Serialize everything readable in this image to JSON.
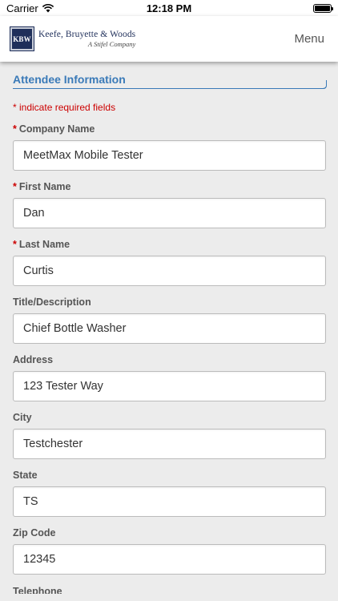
{
  "status_bar": {
    "carrier": "Carrier",
    "time": "12:18 PM"
  },
  "header": {
    "logo_mark": "KBW",
    "logo_name": "Keefe, Bruyette & Woods",
    "logo_subtitle": "A Stifel Company",
    "menu_label": "Menu"
  },
  "form": {
    "section_title": "Attendee Information",
    "required_note": "* indicate required fields",
    "required_marker": "*",
    "fields": [
      {
        "label": "Company Name",
        "value": "MeetMax Mobile Tester"
      },
      {
        "label": "First Name",
        "value": "Dan"
      },
      {
        "label": "Last Name",
        "value": "Curtis"
      },
      {
        "label": "Title/Description",
        "value": "Chief Bottle Washer"
      },
      {
        "label": "Address",
        "value": "123 Tester Way"
      },
      {
        "label": "City",
        "value": "Testchester"
      },
      {
        "label": "State",
        "value": "TS"
      },
      {
        "label": "Zip Code",
        "value": "12345"
      }
    ],
    "next_label_partial": "Telephone"
  },
  "colors": {
    "accent": "#3a7ab8",
    "required": "#cc0000",
    "brand_navy": "#1f2f5a"
  }
}
